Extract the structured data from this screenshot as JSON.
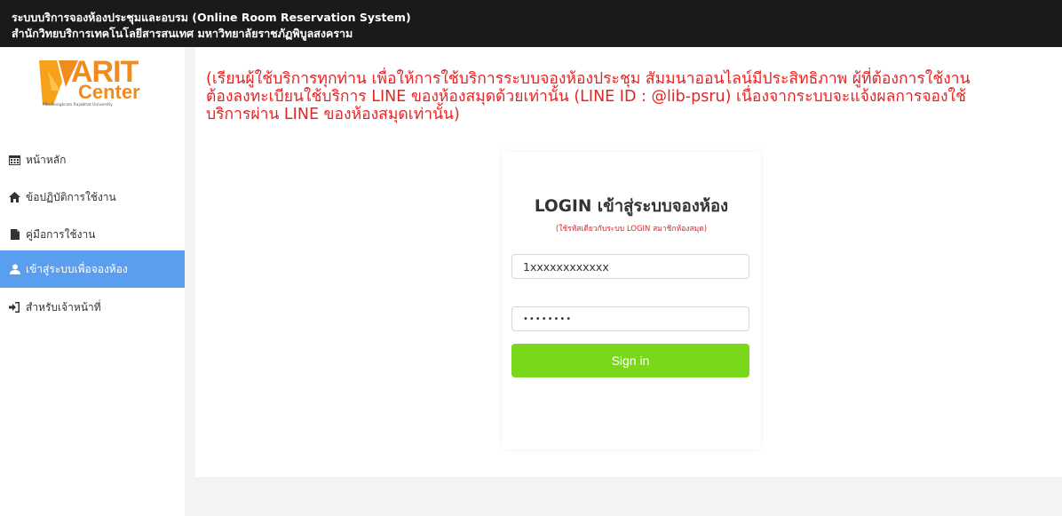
{
  "header": {
    "line1": "ระบบบริการจองห้องประชุมและอบรม (Online Room Reservation System)",
    "line2": "สำนักวิทยบริการเทคโนโลยีสารสนเทศ มหาวิทยาลัยราชภัฏพิบูลสงคราม"
  },
  "logo": {
    "text_main": "ARIT",
    "text_sub": "Center",
    "tagline": "Pibulsongkram Rajabhat University",
    "accent_color": "#f28b1c"
  },
  "sidebar": {
    "items": [
      {
        "label": "หน้าหลัก",
        "icon": "calendar-icon",
        "active": false
      },
      {
        "label": "ข้อปฏิบัติการใช้งาน",
        "icon": "home-icon",
        "active": false
      },
      {
        "label": "คู่มือการใช้งาน",
        "icon": "file-icon",
        "active": false
      },
      {
        "label": "เข้าสู่ระบบเพื่อจองห้อง",
        "icon": "user-icon",
        "active": true
      },
      {
        "label": "สำหรับเจ้าหน้าที่",
        "icon": "sign-in-icon",
        "active": false
      }
    ],
    "active_color": "#5a9ef0"
  },
  "notice": {
    "lines": [
      "(เรียนผู้ใช้บริการทุกท่าน เพื่อให้การใช้บริการระบบจองห้องประชุม สัมมนาออนไลน์มีประสิทธิภาพ ผู้ที่ต้องการใช้งาน",
      "ต้องลงทะเบียนใช้บริการ LINE ของห้องสมุดด้วยเท่านั้น (LINE ID : @lib-psru) เนื่องจากระบบจะแจ้งผลการจองใช้",
      "บริการผ่าน LINE ของห้องสมุดเท่านั้น)"
    ],
    "color": "#e52424"
  },
  "login": {
    "title": "LOGIN เข้าสู่ระบบจองห้อง",
    "subtitle": "(ใช้รหัสเดียวกับระบบ LOGIN สมาชิกห้องสมุด)",
    "username_value": "1xxxxxxxxxxxx",
    "password_value": "••••••••",
    "signin_label": "Sign in",
    "button_color": "#7ad81a"
  }
}
